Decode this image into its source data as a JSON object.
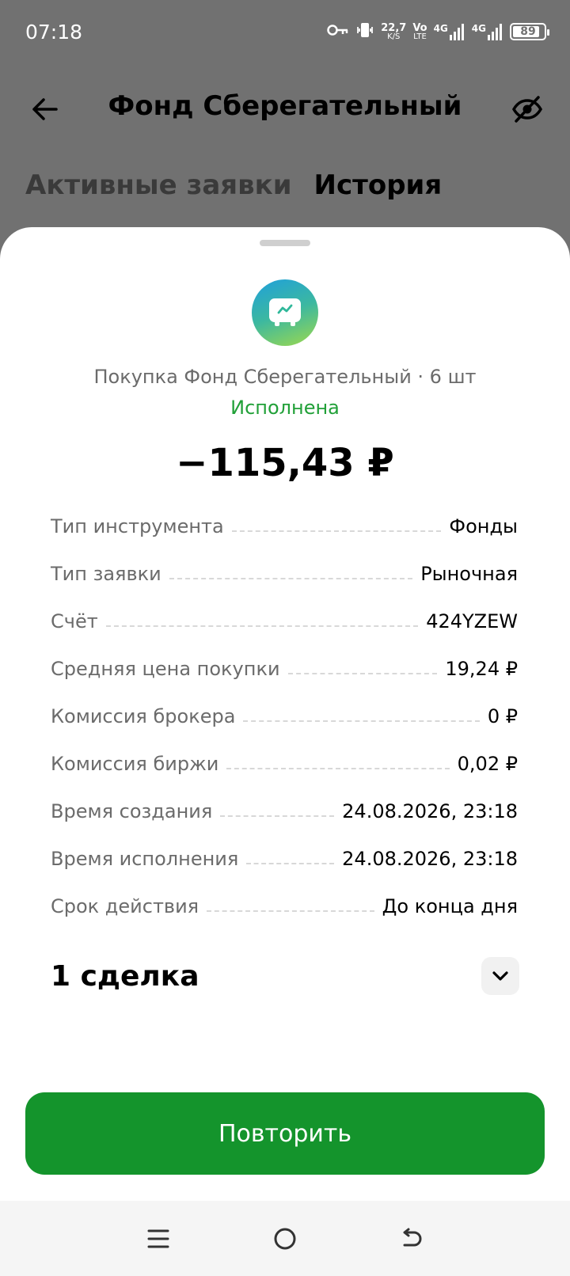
{
  "status_bar": {
    "time": "07:18",
    "speed_value": "22,7",
    "speed_unit": "K/S",
    "volte_top": "Vo",
    "volte_bottom": "LTE",
    "net1": "4G",
    "net2": "4G",
    "battery_level": "89",
    "battery_fraction": 0.89
  },
  "header": {
    "title": "Фонд Сберегательный",
    "back_icon": "arrow-left-icon",
    "visibility_icon": "eye-off-icon"
  },
  "tabs": [
    {
      "label": "Активные заявки",
      "active": false
    },
    {
      "label": "История",
      "active": true
    }
  ],
  "order": {
    "description": "Покупка Фонд Сберегательный · 6 шт",
    "status": "Исполнена",
    "amount": "−115,43 ₽",
    "details": [
      {
        "label": "Тип инструмента",
        "value": "Фонды"
      },
      {
        "label": "Тип заявки",
        "value": "Рыночная"
      },
      {
        "label": "Счёт",
        "value": "424YZEW"
      },
      {
        "label": "Средняя цена покупки",
        "value": "19,24 ₽"
      },
      {
        "label": "Комиссия брокера",
        "value": "0 ₽"
      },
      {
        "label": "Комиссия биржи",
        "value": "0,02 ₽"
      },
      {
        "label": "Время создания",
        "value": "24.08.2026, 23:18"
      },
      {
        "label": "Время исполнения",
        "value": "24.08.2026, 23:18"
      },
      {
        "label": "Срок действия",
        "value": "До конца дня"
      }
    ],
    "deals_title": "1 сделка"
  },
  "repeat_button": "Повторить",
  "colors": {
    "accent_green": "#14942c",
    "status_green": "#21a038",
    "overlay_gray": "#717171"
  },
  "nav": {
    "menu_icon": "menu-icon",
    "home_icon": "home-circle-icon",
    "back_icon": "back-return-icon"
  }
}
